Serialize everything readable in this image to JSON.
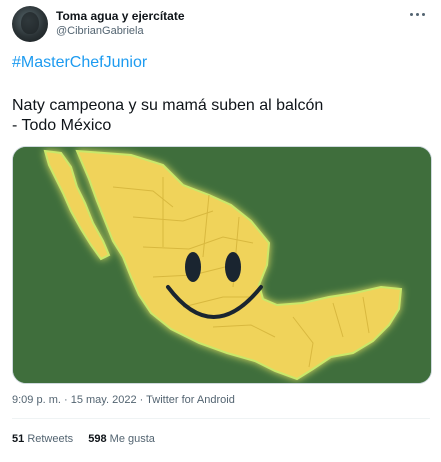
{
  "author": {
    "display_name": "Toma agua y ejercítate",
    "handle": "@CibrianGabriela"
  },
  "tweet": {
    "hashtag": "#MasterChefJunior",
    "line1": "Naty campeona y su mamá suben al balcón",
    "line2": "- Todo México",
    "media_icon": "mexico-map-smiley"
  },
  "meta": {
    "time": "9:09 p. m.",
    "date": "15 may. 2022",
    "source": "Twitter for Android"
  },
  "stats": {
    "retweets_count": "51",
    "retweets_label": "Retweets",
    "likes_count": "598",
    "likes_label": "Me gusta"
  },
  "colors": {
    "accent": "#1d9bf0",
    "map_background": "#3f6e3c",
    "map_fill": "#f0d35a"
  }
}
